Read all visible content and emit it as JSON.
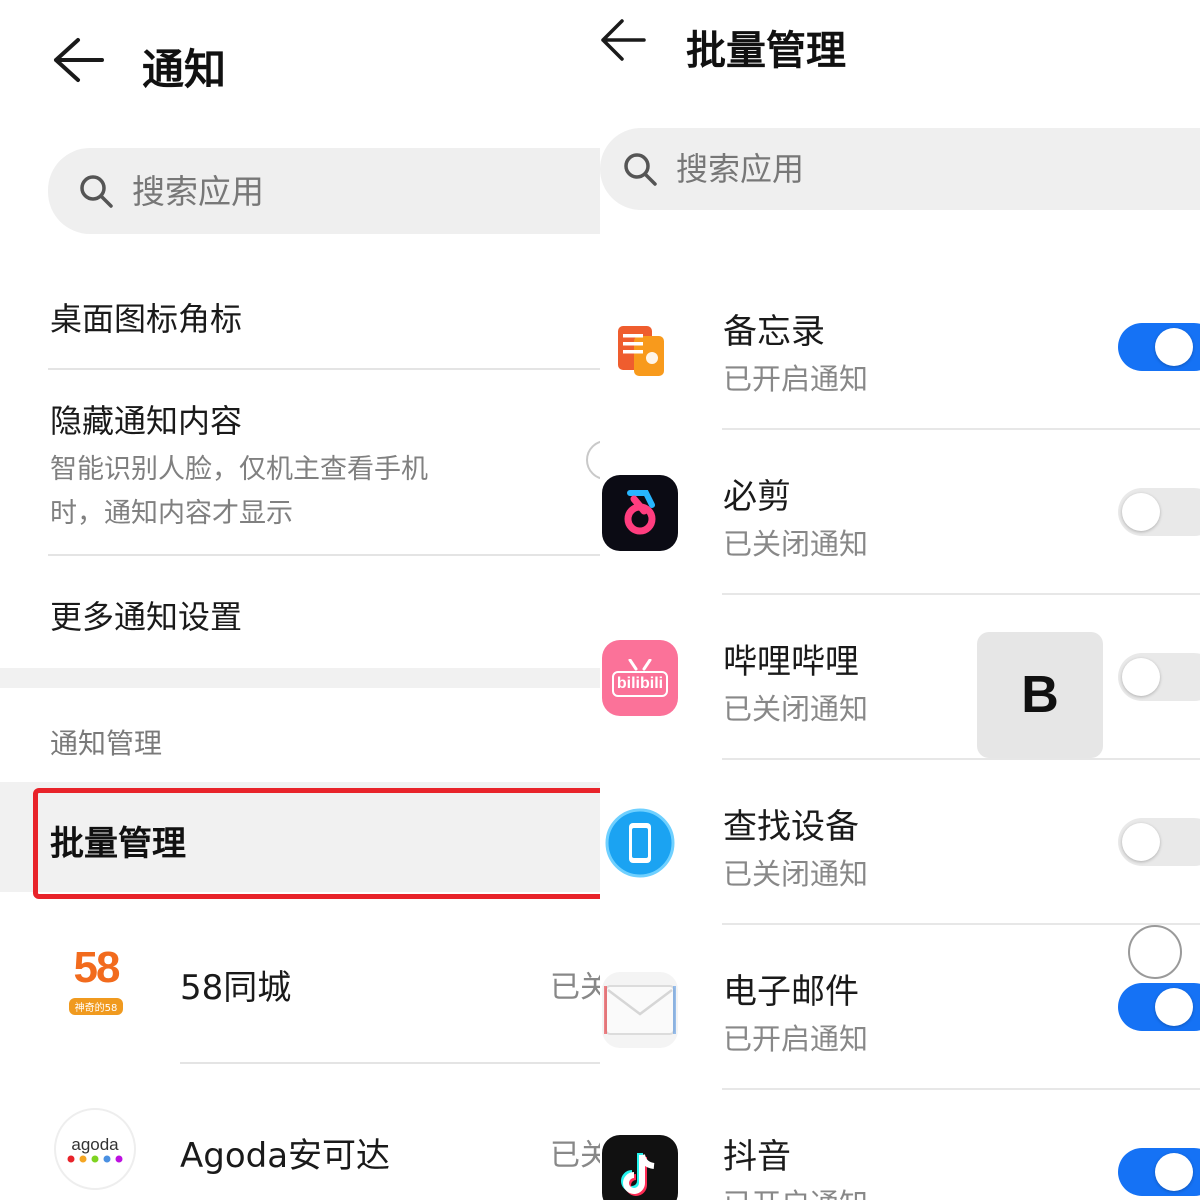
{
  "left": {
    "header": {
      "title": "通知"
    },
    "search": {
      "placeholder": "搜索应用"
    },
    "settings": [
      {
        "title": "桌面图标角标"
      },
      {
        "title": "隐藏通知内容",
        "subtitle_line1": "智能识别人脸，仅机主查看手机",
        "subtitle_line2": "时，通知内容才显示"
      },
      {
        "title": "更多通知设置"
      }
    ],
    "section_label": "通知管理",
    "batch_label": "批量管理",
    "apps": [
      {
        "name": "58同城",
        "status": "已关",
        "icon_text": "58",
        "icon_subtext": "神奇的58"
      },
      {
        "name": "Agoda安可达",
        "status": "已关",
        "icon_text": "agoda"
      }
    ]
  },
  "right": {
    "header": {
      "title": "批量管理"
    },
    "search": {
      "placeholder": "搜索应用"
    },
    "apps": [
      {
        "name": "备忘录",
        "status": "已开启通知",
        "enabled": true,
        "icon": "memo-icon"
      },
      {
        "name": "必剪",
        "status": "已关闭通知",
        "enabled": false,
        "icon": "bijian-icon"
      },
      {
        "name": "哔哩哔哩",
        "status": "已关闭通知",
        "enabled": false,
        "icon": "bilibili-icon",
        "icon_text": "bilibili"
      },
      {
        "name": "查找设备",
        "status": "已关闭通知",
        "enabled": false,
        "icon": "find-device-icon"
      },
      {
        "name": "电子邮件",
        "status": "已开启通知",
        "enabled": true,
        "icon": "email-icon"
      },
      {
        "name": "抖音",
        "status": "已开启通知",
        "enabled": true,
        "icon": "douyin-icon"
      }
    ],
    "overlay_letter": "B"
  },
  "colors": {
    "accent": "#1572f5",
    "highlight": "#e8232a",
    "toggle_off": "#e9e9e9"
  }
}
